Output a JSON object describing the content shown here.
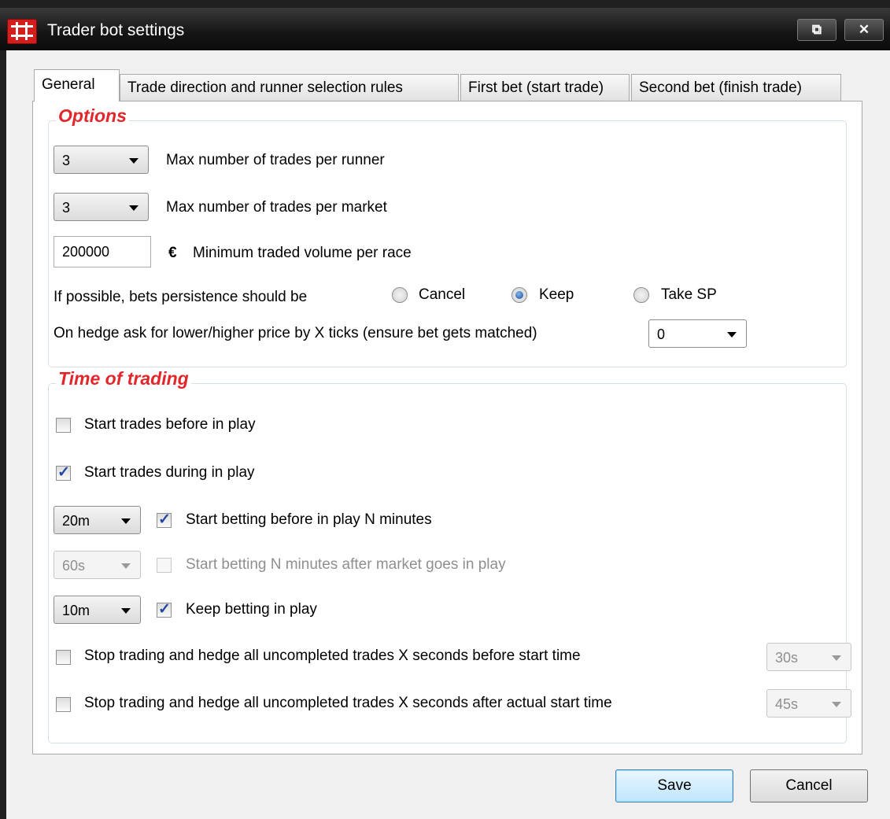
{
  "window": {
    "title": "Trader bot settings",
    "restore_symbol": "⧉",
    "close_symbol": "✕"
  },
  "tabs": [
    {
      "label": "General",
      "active": true
    },
    {
      "label": "Trade direction and runner selection rules",
      "active": false
    },
    {
      "label": "First bet (start trade)",
      "active": false
    },
    {
      "label": "Second bet (finish trade)",
      "active": false
    }
  ],
  "options": {
    "title": "Options",
    "max_trades_runner": {
      "value": "3",
      "label": "Max number of trades per runner"
    },
    "max_trades_market": {
      "value": "3",
      "label": "Max number of trades per market"
    },
    "min_volume": {
      "value": "200000",
      "currency": "€",
      "label": "Minimum traded volume per race"
    },
    "persistence": {
      "label": "If possible, bets persistence should be",
      "choices": [
        "Cancel",
        "Keep",
        "Take SP"
      ],
      "selected": "Keep"
    },
    "hedge_ticks": {
      "label": "On hedge ask for lower/higher price by X ticks (ensure bet gets matched)",
      "value": "0"
    }
  },
  "time_of_trading": {
    "title": "Time of trading",
    "start_before_inplay": {
      "label": "Start trades before in play",
      "checked": false
    },
    "start_during_inplay": {
      "label": "Start trades during in play",
      "checked": true
    },
    "start_betting_before": {
      "select": "20m",
      "label": "Start betting before in play N minutes",
      "checked": true
    },
    "start_betting_after": {
      "select": "60s",
      "label": "Start betting N minutes after market goes in play",
      "checked": false,
      "disabled": true
    },
    "keep_betting": {
      "select": "10m",
      "label": "Keep betting in play",
      "checked": true
    },
    "stop_before": {
      "label": "Stop trading and hedge all uncompleted trades X seconds before start time",
      "checked": false,
      "select": "30s"
    },
    "stop_after": {
      "label": "Stop trading and hedge all uncompleted trades X seconds after actual start time",
      "checked": false,
      "select": "45s"
    }
  },
  "footer": {
    "save_label": "Save",
    "cancel_label": "Cancel"
  },
  "colors": {
    "accent_red": "#e3262a",
    "titlebar": "#141414",
    "check_blue": "#21479f"
  }
}
